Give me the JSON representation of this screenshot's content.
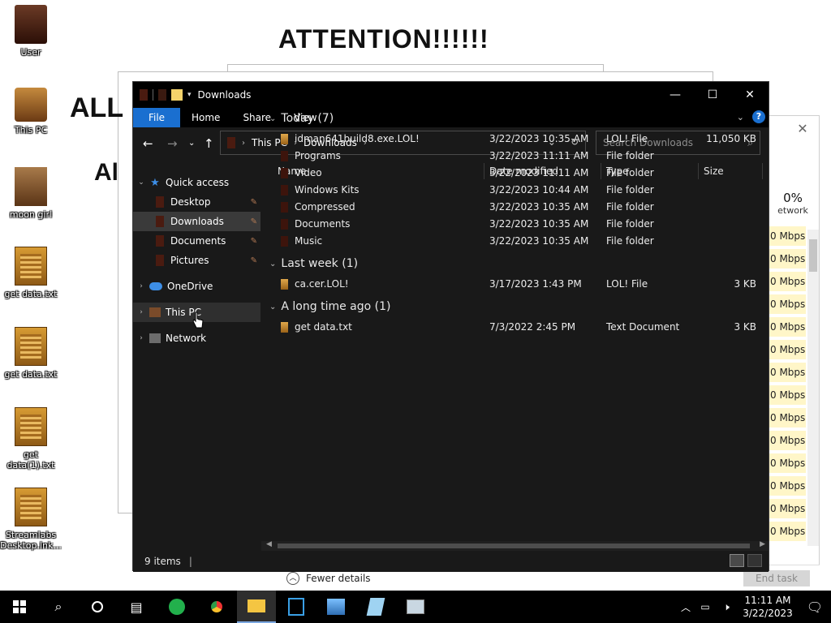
{
  "desktop": {
    "icons": [
      {
        "label": "User"
      },
      {
        "label": "This PC"
      },
      {
        "label": "moon girl"
      },
      {
        "label": "get data.txt"
      },
      {
        "label": "get data.txt"
      },
      {
        "label": "get data(1).txt"
      },
      {
        "label": "Streamlabs Desktop.lnk..."
      }
    ],
    "ransom_title": "ATTENTION!!!!!!",
    "fragment_1": "ALL",
    "fragment_2": "Al"
  },
  "taskmanager": {
    "network_pct": "0%",
    "network_label": "etwork",
    "mbps": "0 Mbps",
    "fewer_details": "Fewer details",
    "end_task": "End task"
  },
  "explorer": {
    "title": "Downloads",
    "ribbon": {
      "file": "File",
      "home": "Home",
      "share": "Share",
      "view": "View"
    },
    "address": {
      "root": "This PC",
      "current": "Downloads"
    },
    "search_placeholder": "Search Downloads",
    "nav": {
      "quick_access": "Quick access",
      "desktop": "Desktop",
      "downloads": "Downloads",
      "documents": "Documents",
      "pictures": "Pictures",
      "onedrive": "OneDrive",
      "this_pc": "This PC",
      "network": "Network"
    },
    "columns": {
      "name": "Name",
      "date": "Date modified",
      "type": "Type",
      "size": "Size"
    },
    "groups": [
      {
        "title": "Today (7)",
        "rows": [
          {
            "name": "idman641build8.exe.LOL!",
            "date": "3/22/2023 10:35 AM",
            "type": "LOL! File",
            "size": "11,050 KB",
            "icon": "orange"
          },
          {
            "name": "Programs",
            "date": "3/22/2023 11:11 AM",
            "type": "File folder",
            "size": "",
            "icon": "dark"
          },
          {
            "name": "Video",
            "date": "3/22/2023 11:11 AM",
            "type": "File folder",
            "size": "",
            "icon": "dark"
          },
          {
            "name": "Windows Kits",
            "date": "3/22/2023 10:44 AM",
            "type": "File folder",
            "size": "",
            "icon": "dark"
          },
          {
            "name": "Compressed",
            "date": "3/22/2023 10:35 AM",
            "type": "File folder",
            "size": "",
            "icon": "dark"
          },
          {
            "name": "Documents",
            "date": "3/22/2023 10:35 AM",
            "type": "File folder",
            "size": "",
            "icon": "dark"
          },
          {
            "name": "Music",
            "date": "3/22/2023 10:35 AM",
            "type": "File folder",
            "size": "",
            "icon": "dark"
          }
        ]
      },
      {
        "title": "Last week (1)",
        "rows": [
          {
            "name": "ca.cer.LOL!",
            "date": "3/17/2023 1:43 PM",
            "type": "LOL! File",
            "size": "3 KB",
            "icon": "orange"
          }
        ]
      },
      {
        "title": "A long time ago (1)",
        "rows": [
          {
            "name": "get data.txt",
            "date": "7/3/2022 2:45 PM",
            "type": "Text Document",
            "size": "3 KB",
            "icon": "orange"
          }
        ]
      }
    ],
    "status": "9 items"
  },
  "taskbar": {
    "time": "11:11 AM",
    "date": "3/22/2023"
  },
  "colors": {
    "accent": "#1a6fd0",
    "explorer_bg": "#191919",
    "titlebar_bg": "#000000",
    "selected_row": "#3a3a3a"
  }
}
